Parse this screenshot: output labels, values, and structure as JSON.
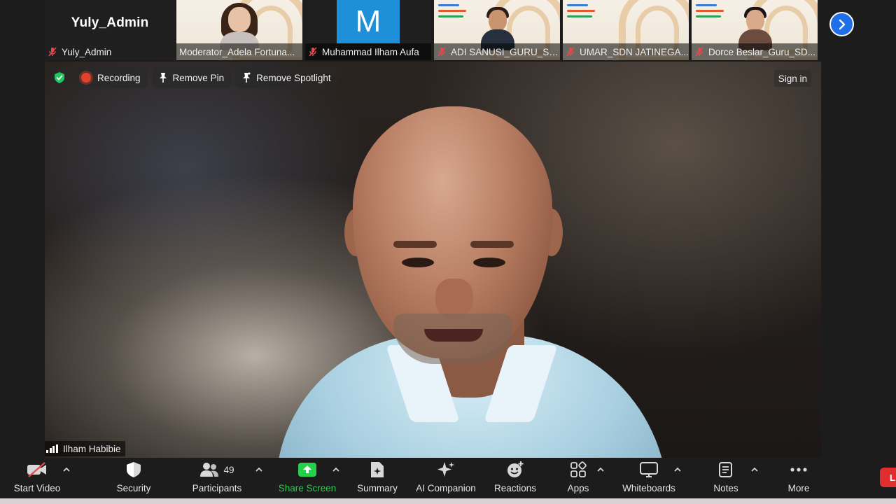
{
  "gallery": {
    "tiles": [
      {
        "name": "Yuly_Admin",
        "display_name": "Yuly_Admin",
        "muted": true
      },
      {
        "name": "Moderator_Adela Fortuna...",
        "muted": false
      },
      {
        "name": "Muhammad Ilham Aufa",
        "avatar_letter": "M",
        "avatar_color": "#1e8fd9",
        "muted": true
      },
      {
        "name": "ADI SANUSI_GURU_SD...",
        "muted": true
      },
      {
        "name": "UMAR_SDN JATINEGA...",
        "muted": true
      },
      {
        "name": "Dorce Beslar_Guru_SD...",
        "muted": true
      }
    ],
    "next_icon": "chevron-right-icon"
  },
  "stage": {
    "recording_label": "Recording",
    "remove_pin_label": "Remove Pin",
    "remove_spotlight_label": "Remove Spotlight",
    "sign_in_label": "Sign in",
    "speaker_name": "Ilham Habibie"
  },
  "toolbar": {
    "start_video": "Start Video",
    "security": "Security",
    "participants": "Participants",
    "participants_count": "49",
    "share_screen": "Share Screen",
    "summary": "Summary",
    "ai_companion": "AI Companion",
    "reactions": "Reactions",
    "apps": "Apps",
    "whiteboards": "Whiteboards",
    "notes": "Notes",
    "more": "More",
    "end_label": "L"
  },
  "colors": {
    "accent_blue": "#1f6fe8",
    "share_green": "#25d04a",
    "record_red": "#e0422c",
    "muted_red": "#e5484d",
    "end_red": "#e02d2d"
  }
}
